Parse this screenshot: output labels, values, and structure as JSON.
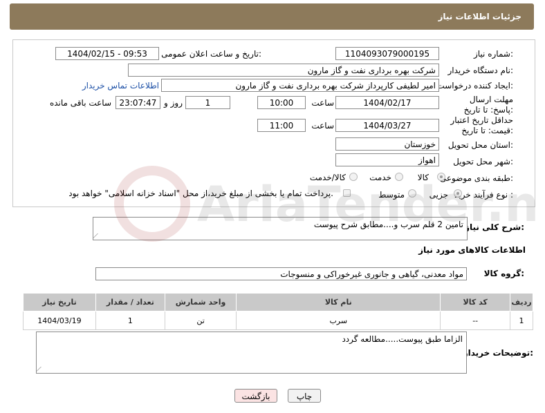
{
  "header": {
    "title": "جزئیات اطلاعات نیاز"
  },
  "form": {
    "need_number_label": "شماره نیاز:",
    "need_number": "1104093079000195",
    "announce_label": "تاریخ و ساعت اعلان عمومی:",
    "announce_value": "1404/02/15 - 09:53",
    "buyer_org_label": "نام دستگاه خریدار:",
    "buyer_org": "شرکت بهره برداری نفت و گاز مارون",
    "creator_label": "ایجاد کننده درخواست:",
    "creator": "امیر لطیفی کارپرداز شرکت بهره برداری نفت و گاز مارون",
    "contact_link": "اطلاعات تماس خریدار",
    "reply_deadline_label": "مهلت ارسال پاسخ: تا تاریخ:",
    "reply_date": "1404/02/17",
    "hour_label": "ساعت",
    "reply_time": "10:00",
    "days_value": "1",
    "days_label": "روز و",
    "remaining_time": "23:07:47",
    "remaining_label": "ساعت باقی مانده",
    "price_deadline_label": "حداقل تاریخ اعتبار قیمت: تا تاریخ:",
    "price_date": "1404/03/27",
    "price_time": "11:00",
    "province_label": "استان محل تحویل:",
    "province": "خوزستان",
    "city_label": "شهر محل تحویل:",
    "city": "اهواز",
    "category_label": "طبقه بندی موضوعی:",
    "category_options": [
      "کالا",
      "خدمت",
      "کالا/خدمت"
    ],
    "process_label": "نوع فرآیند خرید :",
    "process_options": [
      "جزیی",
      "متوسط"
    ],
    "payment_note": "پرداخت تمام یا بخشی از مبلغ خرید،از محل \"اسناد خزانه اسلامی\" خواهد بود."
  },
  "description": {
    "label": "شرح کلی نیاز:",
    "value": "تامین 2 قلم سرب و....مطابق شرح پیوست"
  },
  "goods_section": {
    "title": "اطلاعات کالاهای مورد نیاز",
    "group_label": "گروه کالا:",
    "group_value": "مواد معدنی، گیاهی و جانوری غیرخوراکی و منسوجات",
    "columns": [
      "ردیف",
      "کد کالا",
      "نام کالا",
      "واحد شمارش",
      "تعداد / مقدار",
      "تاریخ نیاز"
    ],
    "rows": [
      {
        "row": "1",
        "code": "--",
        "name": "سرب",
        "unit": "تن",
        "qty": "1",
        "date": "1404/03/19"
      }
    ]
  },
  "buyer_notes": {
    "label": "توضیحات خریدار:",
    "value": "الزاما طبق پیوست.....مطالعه گردد"
  },
  "buttons": {
    "print": "چاپ",
    "back": "بازگشت"
  },
  "watermark": {
    "text": "AriaTender.neT"
  },
  "colors": {
    "header_bg": "#8d7a5b",
    "link": "#1a4ea5",
    "back_button_bg": "#fbe3e3"
  }
}
